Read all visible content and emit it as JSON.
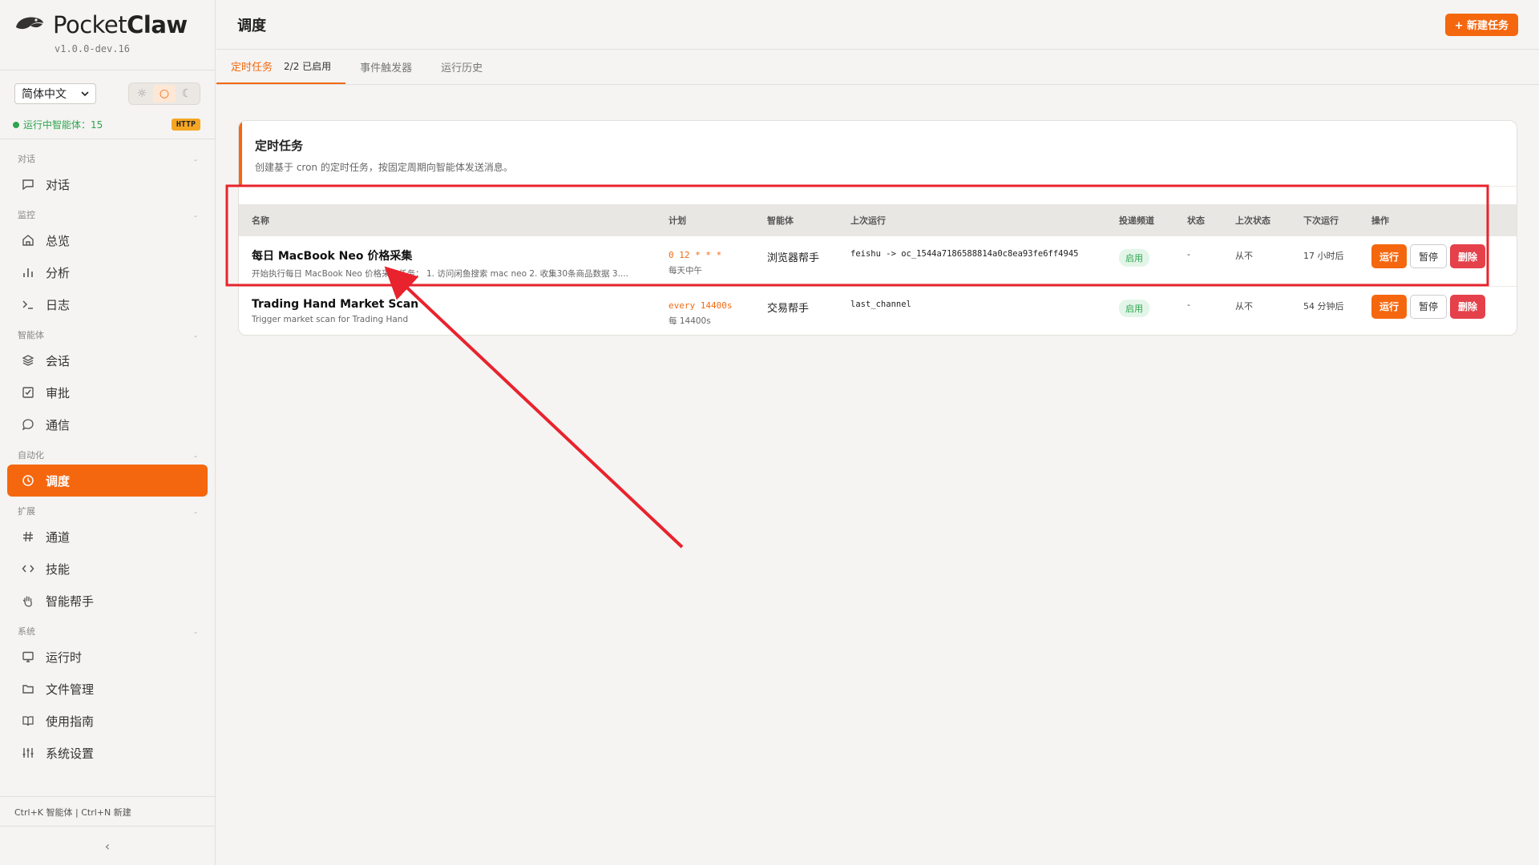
{
  "brand": {
    "name_light": "Pocket",
    "name_bold": "Claw",
    "version": "v1.0.0-dev.16"
  },
  "controls": {
    "language": "简体中文",
    "theme_light": "☼",
    "theme_system": "○",
    "theme_dark": "☾"
  },
  "status": {
    "text": "运行中智能体：15",
    "badge": "HTTP"
  },
  "nav": {
    "sections": [
      {
        "label": "对话",
        "items": [
          {
            "label": "对话",
            "icon": "chat-icon"
          }
        ]
      },
      {
        "label": "监控",
        "items": [
          {
            "label": "总览",
            "icon": "home-icon"
          },
          {
            "label": "分析",
            "icon": "bar-chart-icon"
          },
          {
            "label": "日志",
            "icon": "terminal-icon"
          }
        ]
      },
      {
        "label": "智能体",
        "items": [
          {
            "label": "会话",
            "icon": "layers-icon"
          },
          {
            "label": "审批",
            "icon": "checkbox-icon"
          },
          {
            "label": "通信",
            "icon": "message-icon"
          }
        ]
      },
      {
        "label": "自动化",
        "items": [
          {
            "label": "调度",
            "icon": "clock-icon",
            "active": true
          }
        ]
      },
      {
        "label": "扩展",
        "items": [
          {
            "label": "通道",
            "icon": "hash-icon"
          },
          {
            "label": "技能",
            "icon": "code-icon"
          },
          {
            "label": "智能帮手",
            "icon": "hand-icon"
          }
        ]
      },
      {
        "label": "系统",
        "items": [
          {
            "label": "运行时",
            "icon": "monitor-icon"
          },
          {
            "label": "文件管理",
            "icon": "folder-icon"
          },
          {
            "label": "使用指南",
            "icon": "book-icon"
          },
          {
            "label": "系统设置",
            "icon": "sliders-icon"
          }
        ]
      }
    ],
    "collapse_marker": "-"
  },
  "footer": {
    "shortcuts": "Ctrl+K 智能体 | Ctrl+N 新建",
    "collapse": "‹"
  },
  "header": {
    "title": "调度",
    "new_button": "+ 新建任务"
  },
  "tabs": [
    {
      "label": "定时任务",
      "count": "2/2 已启用",
      "active": true
    },
    {
      "label": "事件触发器"
    },
    {
      "label": "运行历史"
    }
  ],
  "card": {
    "title": "定时任务",
    "description": "创建基于 cron 的定时任务，按固定周期向智能体发送消息。"
  },
  "table": {
    "columns": [
      "名称",
      "计划",
      "智能体",
      "上次运行",
      "投递频道",
      "状态",
      "上次状态",
      "下次运行",
      "操作"
    ],
    "rows": [
      {
        "name": "每日 MacBook Neo 价格采集",
        "desc": "开始执行每日 MacBook Neo 价格采集任务： 1. 访问闲鱼搜索 mac neo 2. 收集30条商品数据 3....",
        "schedule": "0 12 * * *",
        "schedule_sub": "每天中午",
        "agent": "浏览器帮手",
        "last_run": "feishu -> oc_1544a7186588814a0c8ea93fe6ff4945",
        "channel": "启用",
        "status": "-",
        "last_status": "从不",
        "next_run": "17 小时后"
      },
      {
        "name": "Trading Hand Market Scan",
        "desc": "Trigger market scan for Trading Hand",
        "schedule": "every 14400s",
        "schedule_sub": "每 14400s",
        "agent": "交易帮手",
        "last_run": "last_channel",
        "channel": "启用",
        "status": "-",
        "last_status": "从不",
        "next_run": "54 分钟后"
      }
    ],
    "actions": {
      "run": "运行",
      "pause": "暂停",
      "delete": "删除"
    }
  },
  "colors": {
    "accent": "#f5670f",
    "danger": "#e5414b",
    "success": "#2ea44f",
    "annotation": "#e8232d"
  }
}
